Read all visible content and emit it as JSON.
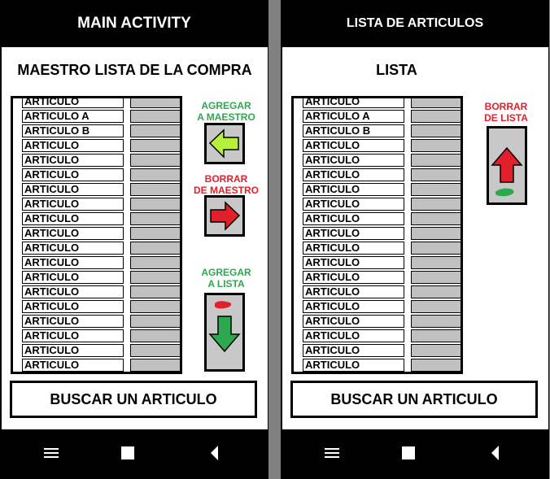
{
  "main_activity": {
    "title": "MAIN ACTIVITY",
    "heading": "MAESTRO LISTA DE LA COMPRA",
    "items": [
      "ARTICULO",
      "ARTICULO A",
      "ARTICULO B",
      "ARTICULO",
      "ARTICULO",
      "ARTICULO",
      "ARTICULO",
      "ARTICULO",
      "ARTICULO",
      "ARTICULO",
      "ARTICULO",
      "ARTICULO",
      "ARTICULO",
      "ARTICULO",
      "ARTICULO",
      "ARTICULO",
      "ARTICULO",
      "ARTICULO",
      "ARTICULO"
    ],
    "agregar_maestro_line1": "AGREGAR",
    "agregar_maestro_line2": "A MAESTRO",
    "borrar_maestro_line1": "BORRAR",
    "borrar_maestro_line2": "DE MAESTRO",
    "agregar_lista_line1": "AGREGAR",
    "agregar_lista_line2": "A LISTA",
    "search_label": "BUSCAR UN ARTICULO"
  },
  "lista_articulos": {
    "title": "LISTA DE ARTICULOS",
    "heading": "LISTA",
    "items": [
      "ARTICULO",
      "ARTICULO A",
      "ARTICULO B",
      "ARTICULO",
      "ARTICULO",
      "ARTICULO",
      "ARTICULO",
      "ARTICULO",
      "ARTICULO",
      "ARTICULO",
      "ARTICULO",
      "ARTICULO",
      "ARTICULO",
      "ARTICULO",
      "ARTICULO",
      "ARTICULO",
      "ARTICULO",
      "ARTICULO",
      "ARTICULO"
    ],
    "borrar_lista_line1": "BORRAR",
    "borrar_lista_line2": "DE LISTA",
    "search_label": "BUSCAR UN ARTICULO"
  },
  "colors": {
    "green": "#2ea84e",
    "red": "#e2202c",
    "lime_arrow": "#b6f03a",
    "button_gray": "#c8c8c8"
  },
  "icons": [
    "menu-icon",
    "home-square-icon",
    "back-triangle-icon",
    "arrow-left-icon",
    "arrow-right-icon",
    "arrow-down-icon",
    "arrow-up-icon",
    "scribble-icon"
  ]
}
